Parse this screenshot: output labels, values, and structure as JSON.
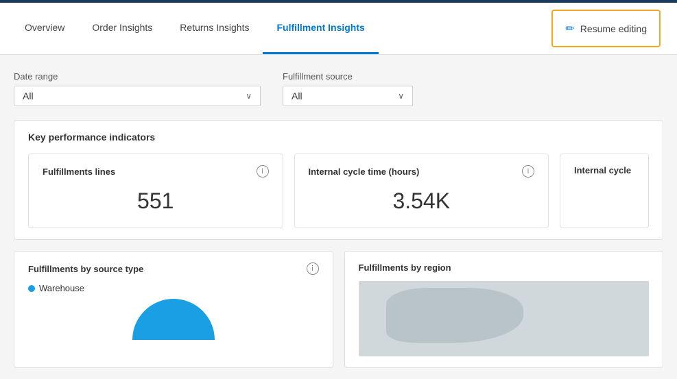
{
  "nav": {
    "tabs": [
      {
        "id": "overview",
        "label": "Overview",
        "active": false
      },
      {
        "id": "order-insights",
        "label": "Order Insights",
        "active": false
      },
      {
        "id": "returns-insights",
        "label": "Returns Insights",
        "active": false
      },
      {
        "id": "fulfillment-insights",
        "label": "Fulfillment Insights",
        "active": true
      }
    ],
    "resume_editing_label": "Resume editing",
    "pencil_icon": "✏"
  },
  "filters": {
    "date_range": {
      "label": "Date range",
      "value": "All",
      "placeholder": "All"
    },
    "fulfillment_source": {
      "label": "Fulfillment source",
      "value": "All",
      "placeholder": "All"
    }
  },
  "kpi": {
    "section_title": "Key performance indicators",
    "cards": [
      {
        "id": "fulfillment-lines",
        "title": "Fulfillments lines",
        "value": "551"
      },
      {
        "id": "internal-cycle-time",
        "title": "Internal cycle time (hours)",
        "value": "3.54K"
      },
      {
        "id": "internal-cycle-partial",
        "title": "Internal cycle",
        "value": ""
      }
    ]
  },
  "bottom_sections": {
    "fulfillments_by_source": {
      "title": "Fulfillments by source type",
      "legend": [
        {
          "label": "Warehouse",
          "color": "#1a9fe4"
        }
      ]
    },
    "fulfillments_by_region": {
      "title": "Fulfillments by region"
    }
  },
  "icons": {
    "info": "i",
    "chevron_down": "∨"
  },
  "colors": {
    "accent_blue": "#0078d4",
    "nav_dark": "#1a3a5c",
    "resume_border": "#f5a623",
    "warehouse_blue": "#1a9fe4"
  }
}
